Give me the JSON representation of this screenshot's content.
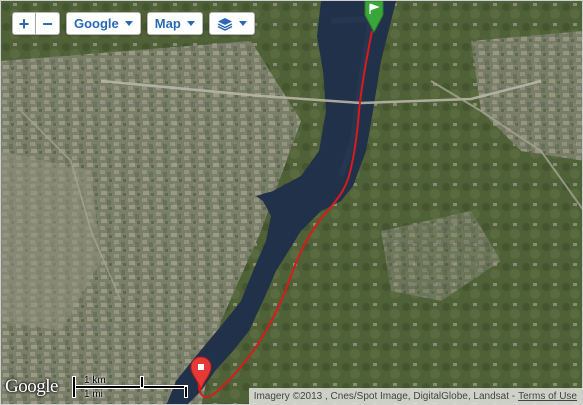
{
  "controls": {
    "zoom_in": "+",
    "zoom_out": "−",
    "provider_label": "Google",
    "map_type_label": "Map",
    "layers_icon": "layers-icon"
  },
  "logo": {
    "text": "Google"
  },
  "scale": {
    "metric_label": "1 km",
    "imperial_label": "1 mi"
  },
  "attribution": {
    "text": "Imagery ©2013 , Cnes/Spot Image, DigitalGlobe, Landsat -",
    "terms_link": "Terms of Use"
  },
  "route": {
    "color": "#d81b1b"
  },
  "markers": {
    "start": {
      "icon": "green-flag-marker-icon",
      "color": "#3aa53a"
    },
    "end": {
      "icon": "red-pin-marker-icon",
      "color": "#e53935"
    }
  },
  "colors": {
    "water": "#22314a",
    "land": "#5d6b45",
    "urban": "#8c8e7a"
  }
}
